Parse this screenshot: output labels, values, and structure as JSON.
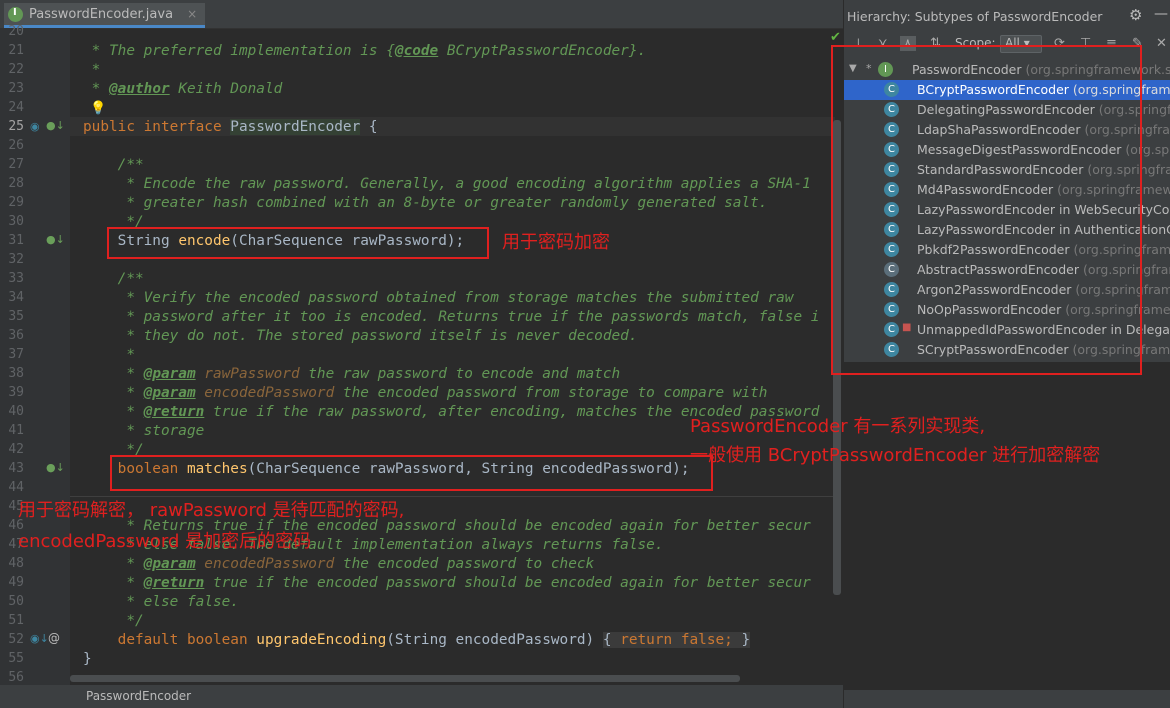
{
  "editor": {
    "tab_label": "PasswordEncoder.java",
    "tab_close": "×",
    "status_text": "PasswordEncoder",
    "line_numbers": [
      "20",
      "21",
      "22",
      "23",
      "24",
      "25",
      "26",
      "27",
      "28",
      "29",
      "30",
      "31",
      "32",
      "33",
      "34",
      "35",
      "36",
      "37",
      "38",
      "39",
      "40",
      "41",
      "42",
      "43",
      "44",
      "45",
      "46",
      "47",
      "48",
      "49",
      "50",
      "51",
      "52",
      "55",
      "56"
    ],
    "lines": {
      "l21": " * The preferred implementation is {",
      "l21b": "@code",
      "l21c": " BCryptPasswordEncoder}.",
      "l22": " *",
      "l23a": " * ",
      "l23b": "@author",
      "l23c": " Keith Donald",
      "l25a": "public interface ",
      "l25b": "PasswordEncoder",
      "l25c": " {",
      "l27": "    /**",
      "l28": "     * Encode the raw password. Generally, a good encoding algorithm applies a SHA-1",
      "l29": "     * greater hash combined with an 8-byte or greater randomly generated salt.",
      "l30": "     */",
      "l31a": "    String ",
      "l31b": "encode",
      "l31c": "(CharSequence rawPassword);",
      "l33": "    /**",
      "l34": "     * Verify the encoded password obtained from storage matches the submitted raw",
      "l35": "     * password after it too is encoded. Returns true if the passwords match, false i",
      "l36": "     * they do not. The stored password itself is never decoded.",
      "l37": "     *",
      "l38a": "     * ",
      "l38b": "@param",
      "l38c": " rawPassword",
      "l38d": " the raw password to encode and match",
      "l39a": "     * ",
      "l39b": "@param",
      "l39c": " encodedPassword",
      "l39d": " the encoded password from storage to compare with",
      "l40a": "     * ",
      "l40b": "@return",
      "l40c": " true if the raw password, after encoding, matches the encoded password",
      "l41": "     * storage",
      "l42": "     */",
      "l43a": "    boolean ",
      "l43b": "matches",
      "l43c": "(CharSequence rawPassword, String encodedPassword);",
      "l46": "     * Returns true if the encoded password should be encoded again for better secur",
      "l47": "     * else false. The default implementation always returns false.",
      "l48a": "     * ",
      "l48b": "@param",
      "l48c": " encodedPassword",
      "l48d": " the encoded password to check",
      "l49a": "     * ",
      "l49b": "@return",
      "l49c": " true if the encoded password should be encoded again for better secur",
      "l50": "     * else false.",
      "l51": "     */",
      "l52a": "    default boolean ",
      "l52b": "upgradeEncoding",
      "l52c": "(String encodedPassword) ",
      "l52d": "{ ",
      "l52e": "return false;",
      "l52f": " }",
      "l55": "}"
    }
  },
  "hierarchy": {
    "title": "Hierarchy:  Subtypes of PasswordEncoder",
    "scope_label": "Scope:",
    "scope_value": "All",
    "root": {
      "name": "PasswordEncoder",
      "pkg": " (org.springframework.sec"
    },
    "items": [
      {
        "name": "BCryptPasswordEncoder",
        "pkg": " (org.springframew"
      },
      {
        "name": "DelegatingPasswordEncoder",
        "pkg": " (org.springfra"
      },
      {
        "name": "LdapShaPasswordEncoder",
        "pkg": " (org.springframe"
      },
      {
        "name": "MessageDigestPasswordEncoder",
        "pkg": " (org.sprin"
      },
      {
        "name": "StandardPasswordEncoder",
        "pkg": " (org.springfram"
      },
      {
        "name": "Md4PasswordEncoder",
        "pkg": " (org.springframewo"
      },
      {
        "name": "LazyPasswordEncoder in WebSecurityConfig",
        "pkg": ""
      },
      {
        "name": "LazyPasswordEncoder in AuthenticationCon",
        "pkg": ""
      },
      {
        "name": "Pbkdf2PasswordEncoder",
        "pkg": " (org.springframew"
      },
      {
        "name": "AbstractPasswordEncoder",
        "pkg": " (org.springframe"
      },
      {
        "name": "Argon2PasswordEncoder",
        "pkg": " (org.springframe"
      },
      {
        "name": "NoOpPasswordEncoder",
        "pkg": " (org.springframew"
      },
      {
        "name": "UnmappedIdPasswordEncoder in Delegatin",
        "pkg": ""
      },
      {
        "name": "SCryptPasswordEncoder",
        "pkg": " (org.springframew"
      }
    ]
  },
  "annotations": {
    "encode_note": "用于密码加密",
    "impl_note_1": "PasswordEncoder 有一系列实现类,",
    "impl_note_2": "一般使用 BCryptPasswordEncoder 进行加密解密",
    "matches_note_1": "用于密码解密， rawPassword 是待匹配的密码,",
    "matches_note_2": "encodedPassword 是加密后的密码"
  },
  "colors": {
    "annotation_red": "#e0201f",
    "selection_blue": "#2f65ca",
    "comment_green": "#629755",
    "keyword_orange": "#cc7832",
    "method_yellow": "#ffc66d"
  }
}
